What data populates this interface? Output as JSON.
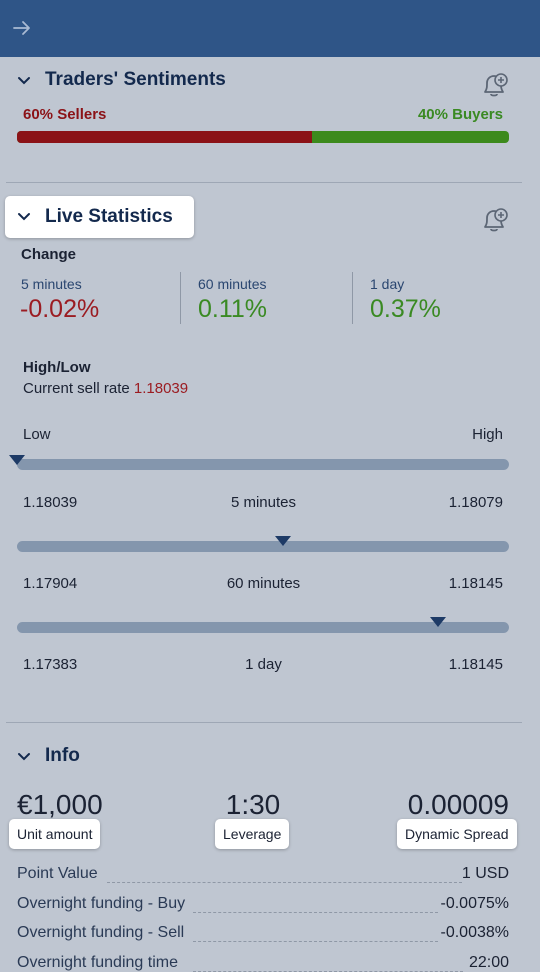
{
  "topbar": {
    "back_icon": "arrow-right-icon"
  },
  "sentiments": {
    "title": "Traders' Sentiments",
    "sellers_label": "60% Sellers",
    "buyers_label": "40% Buyers",
    "sellers_fraction": 0.6,
    "colors": {
      "sellers": "#8b1217",
      "buyers": "#3c8a1c"
    }
  },
  "live": {
    "title": "Live Statistics",
    "change_heading": "Change",
    "changes": [
      {
        "period": "5 minutes",
        "value": "-0.02%"
      },
      {
        "period": "60 minutes",
        "value": "0.11%"
      },
      {
        "period": "1 day",
        "value": "0.37%"
      }
    ],
    "highlow_heading": "High/Low",
    "sell_rate_label": "Current sell rate",
    "sell_rate_value": "1.18039",
    "low_label": "Low",
    "high_label": "High",
    "ranges": [
      {
        "period": "5 minutes",
        "low": "1.18039",
        "high": "1.18079",
        "position": 0.0
      },
      {
        "period": "60 minutes",
        "low": "1.17904",
        "high": "1.18145",
        "position": 0.54
      },
      {
        "period": "1 day",
        "low": "1.17383",
        "high": "1.18145",
        "position": 0.855
      }
    ]
  },
  "info": {
    "title": "Info",
    "unit_amount_value": "€1,000",
    "unit_amount_label": "Unit amount",
    "leverage_value": "1:30",
    "leverage_label": "Leverage",
    "spread_value": "0.00009",
    "spread_label": "Dynamic Spread",
    "rows": [
      {
        "label": "Point Value",
        "value": "1 USD"
      },
      {
        "label": "Overnight funding - Buy",
        "value": "-0.0075%"
      },
      {
        "label": "Overnight funding - Sell",
        "value": "-0.0038%"
      },
      {
        "label": "Overnight funding time",
        "value": "22:00"
      }
    ]
  }
}
